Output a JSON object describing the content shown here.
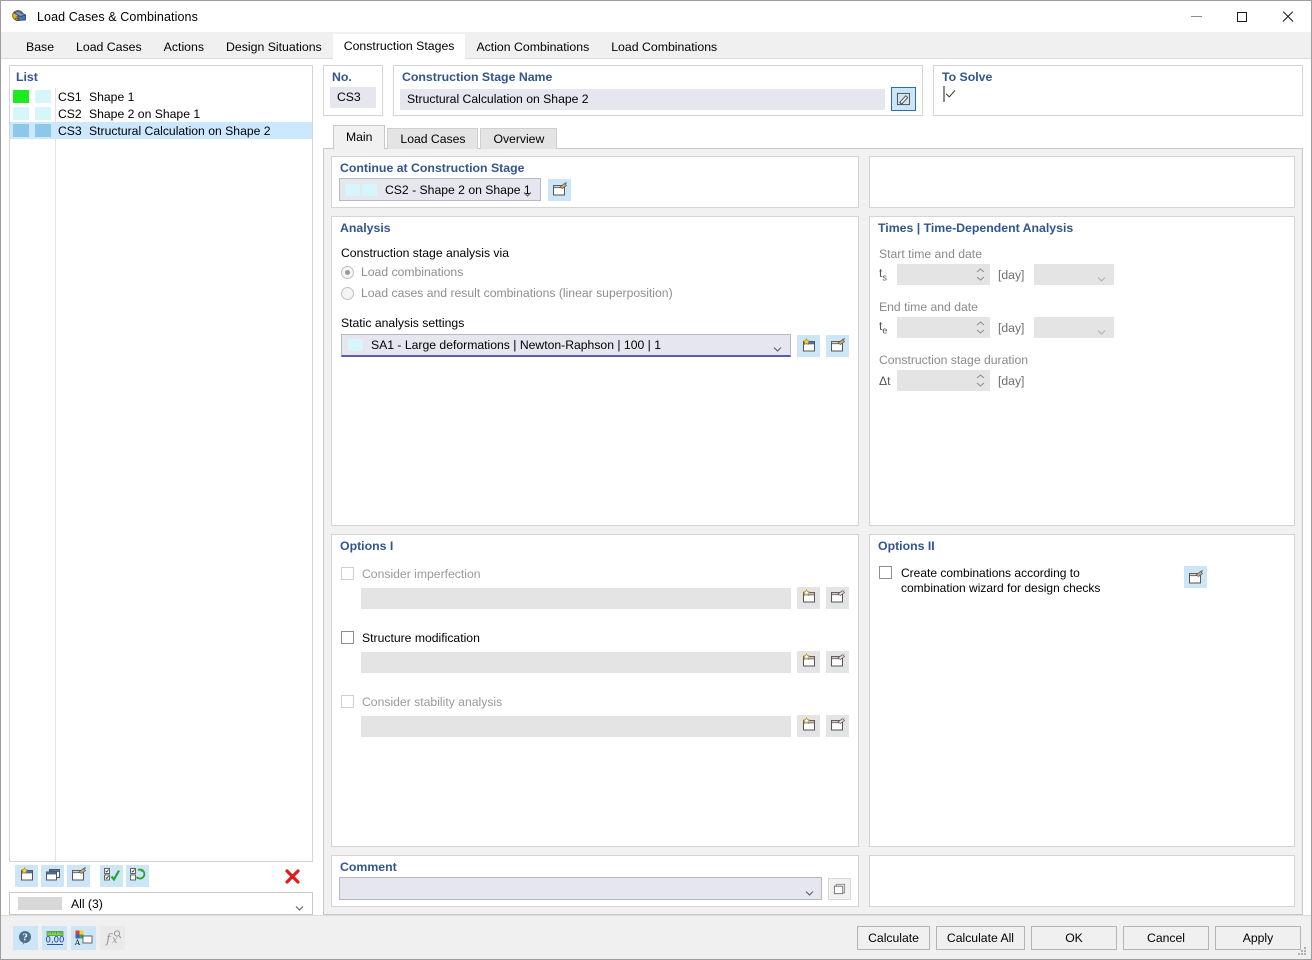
{
  "window": {
    "title": "Load Cases & Combinations",
    "icon": "app-icon",
    "minimize": "minimize",
    "maximize": "maximize",
    "close": "close"
  },
  "tabs": [
    {
      "label": "Base",
      "active": false
    },
    {
      "label": "Load Cases",
      "active": false
    },
    {
      "label": "Actions",
      "active": false
    },
    {
      "label": "Design Situations",
      "active": false
    },
    {
      "label": "Construction Stages",
      "active": true
    },
    {
      "label": "Action Combinations",
      "active": false
    },
    {
      "label": "Load Combinations",
      "active": false
    }
  ],
  "list": {
    "header": "List",
    "rows": [
      {
        "no": "CS1",
        "name": "Shape 1",
        "color1": "#1eeb1e",
        "color2": "#d6f6fb",
        "selected": false
      },
      {
        "no": "CS2",
        "name": "Shape 2 on Shape 1",
        "color1": "#d6f6fb",
        "color2": "#d6f6fb",
        "selected": false
      },
      {
        "no": "CS3",
        "name": "Structural Calculation on Shape 2",
        "color1": "#8ec8e8",
        "color2": "#8ec8e8",
        "selected": true
      }
    ],
    "toolbar": [
      {
        "name": "new-icon",
        "label": "New"
      },
      {
        "name": "copy-icon",
        "label": "Copy"
      },
      {
        "name": "edit-icon",
        "label": "Edit"
      },
      {
        "name": "select-all-icon",
        "label": "Select All"
      },
      {
        "name": "invert-selection-icon",
        "label": "Invert Selection"
      }
    ],
    "delete_label": "Delete",
    "filter": {
      "value": "All (3)",
      "swatch": "#d8d8d8"
    }
  },
  "detail": {
    "no": {
      "title": "No.",
      "value": "CS3"
    },
    "name": {
      "title": "Construction Stage Name",
      "value": "Structural Calculation on Shape 2",
      "edit_button": "edit-name"
    },
    "to_solve": {
      "title": "To Solve",
      "checked": true
    }
  },
  "inner_tabs": [
    {
      "label": "Main",
      "active": true
    },
    {
      "label": "Load Cases",
      "active": false
    },
    {
      "label": "Overview",
      "active": false
    }
  ],
  "continue_stage": {
    "title": "Continue at Construction Stage",
    "value": "CS2 - Shape 2 on Shape 1",
    "swatch1": "#d6f6fb",
    "swatch2": "#d6f6fb",
    "edit_button": "edit-stage"
  },
  "analysis": {
    "title": "Analysis",
    "via_label": "Construction stage analysis via",
    "options": [
      {
        "label": "Load combinations",
        "selected": true
      },
      {
        "label": "Load cases and result combinations (linear superposition)",
        "selected": false
      }
    ],
    "static_label": "Static analysis settings",
    "static_value": "SA1 - Large deformations | Newton-Raphson | 100 | 1",
    "static_swatch": "#d6f6fb",
    "new_button": "new-static-analysis",
    "edit_button": "edit-static-analysis"
  },
  "times": {
    "title": "Times | Time-Dependent Analysis",
    "start_label": "Start time and date",
    "start_symbol": "ts",
    "start_value": "",
    "start_unit": "[day]",
    "start_date": "",
    "end_label": "End time and date",
    "end_symbol": "te",
    "end_value": "",
    "end_unit": "[day]",
    "end_date": "",
    "duration_label": "Construction stage duration",
    "duration_symbol": "Δt",
    "duration_value": "",
    "duration_unit": "[day]"
  },
  "options1": {
    "title": "Options I",
    "items": [
      {
        "label": "Consider imperfection",
        "checked": false,
        "disabled": true,
        "field": "",
        "new_button": "new-imperfection",
        "edit_button": "edit-imperfection"
      },
      {
        "label": "Structure modification",
        "checked": false,
        "disabled": false,
        "field": "",
        "new_button": "new-structure-modification",
        "edit_button": "edit-structure-modification"
      },
      {
        "label": "Consider stability analysis",
        "checked": false,
        "disabled": true,
        "field": "",
        "new_button": "new-stability-analysis",
        "edit_button": "edit-stability-analysis"
      }
    ]
  },
  "options2": {
    "title": "Options II",
    "item": {
      "label_line1": "Create combinations according to",
      "label_line2": "combination wizard for design checks",
      "checked": false,
      "edit_button": "edit-combination-wizard"
    }
  },
  "comment": {
    "title": "Comment",
    "value": "",
    "browse_button": "comment-browse"
  },
  "footer": {
    "tools": [
      {
        "name": "info-icon",
        "label": "Info"
      },
      {
        "name": "units-icon",
        "label": "Units and Decimal Places"
      },
      {
        "name": "colors-icon",
        "label": "Display Properties"
      },
      {
        "name": "formula-icon",
        "label": "Formula"
      }
    ],
    "buttons": [
      {
        "label": "Calculate",
        "name": "calculate-button"
      },
      {
        "label": "Calculate All",
        "name": "calculate-all-button"
      },
      {
        "label": "OK",
        "name": "ok-button"
      },
      {
        "label": "Cancel",
        "name": "cancel-button"
      },
      {
        "label": "Apply",
        "name": "apply-button"
      }
    ]
  }
}
